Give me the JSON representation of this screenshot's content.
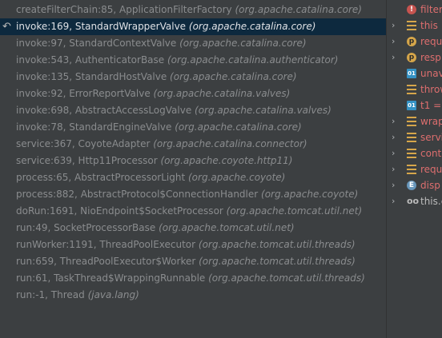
{
  "frames": [
    {
      "method": "createFilterChain:85, ApplicationFilterFactory",
      "package": "(org.apache.catalina.core)",
      "selected": false
    },
    {
      "method": "invoke:169, StandardWrapperValve",
      "package": "(org.apache.catalina.core)",
      "selected": true
    },
    {
      "method": "invoke:97, StandardContextValve",
      "package": "(org.apache.catalina.core)",
      "selected": false
    },
    {
      "method": "invoke:543, AuthenticatorBase",
      "package": "(org.apache.catalina.authenticator)",
      "selected": false
    },
    {
      "method": "invoke:135, StandardHostValve",
      "package": "(org.apache.catalina.core)",
      "selected": false
    },
    {
      "method": "invoke:92, ErrorReportValve",
      "package": "(org.apache.catalina.valves)",
      "selected": false
    },
    {
      "method": "invoke:698, AbstractAccessLogValve",
      "package": "(org.apache.catalina.valves)",
      "selected": false
    },
    {
      "method": "invoke:78, StandardEngineValve",
      "package": "(org.apache.catalina.core)",
      "selected": false
    },
    {
      "method": "service:367, CoyoteAdapter",
      "package": "(org.apache.catalina.connector)",
      "selected": false
    },
    {
      "method": "service:639, Http11Processor",
      "package": "(org.apache.coyote.http11)",
      "selected": false
    },
    {
      "method": "process:65, AbstractProcessorLight",
      "package": "(org.apache.coyote)",
      "selected": false
    },
    {
      "method": "process:882, AbstractProtocol$ConnectionHandler",
      "package": "(org.apache.coyote)",
      "selected": false
    },
    {
      "method": "doRun:1691, NioEndpoint$SocketProcessor",
      "package": "(org.apache.tomcat.util.net)",
      "selected": false
    },
    {
      "method": "run:49, SocketProcessorBase",
      "package": "(org.apache.tomcat.util.net)",
      "selected": false
    },
    {
      "method": "runWorker:1191, ThreadPoolExecutor",
      "package": "(org.apache.tomcat.util.threads)",
      "selected": false
    },
    {
      "method": "run:659, ThreadPoolExecutor$Worker",
      "package": "(org.apache.tomcat.util.threads)",
      "selected": false
    },
    {
      "method": "run:61, TaskThread$WrappingRunnable",
      "package": "(org.apache.tomcat.util.threads)",
      "selected": false
    },
    {
      "method": "run:-1, Thread",
      "package": "(java.lang)",
      "selected": false
    }
  ],
  "variables": [
    {
      "name": "filter",
      "icon": "error-icon",
      "glyph": "!",
      "expandable": false
    },
    {
      "name": "this =",
      "icon": "object-icon",
      "glyph": "",
      "expandable": true
    },
    {
      "name": "requ",
      "icon": "parameter-icon",
      "glyph": "p",
      "expandable": true
    },
    {
      "name": "resp",
      "icon": "parameter-icon",
      "glyph": "p",
      "expandable": true
    },
    {
      "name": "unav",
      "icon": "primitive-icon",
      "glyph": "01",
      "expandable": false
    },
    {
      "name": "throw",
      "icon": "object-icon",
      "glyph": "",
      "expandable": false
    },
    {
      "name": "t1 =",
      "icon": "primitive-icon",
      "glyph": "01",
      "expandable": false
    },
    {
      "name": "wrap",
      "icon": "object-icon",
      "glyph": "",
      "expandable": true
    },
    {
      "name": "servi",
      "icon": "object-icon",
      "glyph": "",
      "expandable": true
    },
    {
      "name": "conte",
      "icon": "object-icon",
      "glyph": "",
      "expandable": true
    },
    {
      "name": "requ",
      "icon": "object-icon",
      "glyph": "",
      "expandable": true
    },
    {
      "name": "disp",
      "icon": "enum-icon",
      "glyph": "E",
      "expandable": true
    },
    {
      "name": "this.c",
      "icon": "watch-icon",
      "glyph": "oo",
      "expandable": true
    }
  ],
  "colors": {
    "background": "#3c3f41",
    "selected_row": "#0d293e",
    "frame_text": "#8a8c8e",
    "variable_name": "#dd6e6e"
  }
}
